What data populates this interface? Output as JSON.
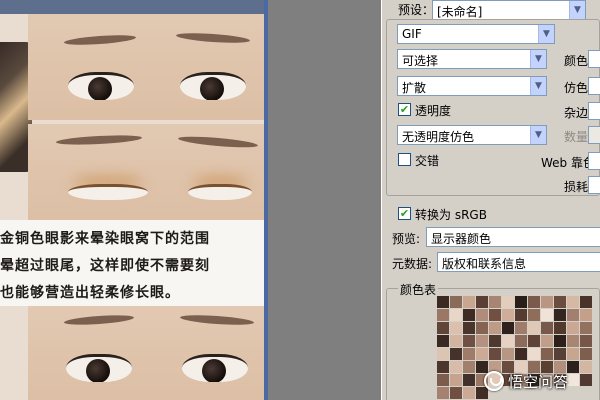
{
  "preview": {
    "caption_lines": [
      "金铜色眼影来晕染眼窝下的范围",
      "晕超过眼尾，这样即使不需要刻",
      "也能够营造出轻柔修长眼。"
    ]
  },
  "settings": {
    "preset_label": "预设：",
    "preset_value": "[未命名]",
    "format_value": "GIF",
    "reduction_value": "可选择",
    "colors_label": "颜色:",
    "dither_algo_value": "扩散",
    "dither_label": "仿色:",
    "transparency_label": "透明度",
    "transparency_checked": true,
    "matte_label": "杂边:",
    "transparency_dither_value": "无透明度仿色",
    "amount_label": "数量:",
    "interlaced_label": "交错",
    "interlaced_checked": false,
    "web_snap_label": "Web 靠色:",
    "lossy_label": "损耗:",
    "convert_srgb_label": "转换为 sRGB",
    "convert_srgb_checked": true,
    "preview_label": "预览:",
    "preview_value": "显示器颜色",
    "metadata_label": "元数据:",
    "metadata_value": "版权和联系信息",
    "color_table_label": "颜色表",
    "color_table": [
      "#3b2a22",
      "#8a6a58",
      "#c9a68f",
      "#5a4034",
      "#a88472",
      "#e3cdbd",
      "#2a1e18",
      "#7a5b4b",
      "#b99582",
      "#6b4d40",
      "#d6b8a5",
      "#4a3329",
      "#9b7866",
      "#e8d6c8",
      "#3e2c24",
      "#b08d7a",
      "#724f41",
      "#cfae99",
      "#563c30",
      "#8f6d5b",
      "#f0e2d6",
      "#332520",
      "#a3806d",
      "#c4a08b",
      "#604538",
      "#dbc0ad",
      "#49352c",
      "#866454",
      "#bd9b87",
      "#2f221c",
      "#a07d6b",
      "#e0c8b7",
      "#77584a",
      "#52392e",
      "#caa893",
      "#93715f",
      "#3a2922",
      "#d2b4a0",
      "#6e5144",
      "#b49180",
      "#4f382e",
      "#e6d1c2",
      "#8c6b5a",
      "#5e4336",
      "#c19e89",
      "#2c201a",
      "#a98672",
      "#765647",
      "#dcc4b2",
      "#45322a",
      "#9e7c69",
      "#cdaa95",
      "#684b3e",
      "#b89684",
      "#3d2b23",
      "#ecdcd0",
      "#82614f",
      "#574036",
      "#c7a58f",
      "#7e5f4f",
      "#4c362c",
      "#d8bca9",
      "#a1806e",
      "#35271f",
      "#bf9c88",
      "#6a4c3f",
      "#e4cfbf",
      "#8e6c5b",
      "#59402f",
      "#b28f7c",
      "#2e211b",
      "#d4b7a3",
      "#7c5d4d",
      "#c6a38e",
      "#42302a",
      "#9a7765",
      "#e1c9b8",
      "#634637",
      "#ae8b78",
      "#392923",
      "#d0b29e",
      "#866555",
      "#f2e6dc",
      "#503a31",
      "#a5826f",
      "#704f42",
      "#cba995",
      "#3f2d26"
    ]
  },
  "watermark": {
    "text": "悟空问答"
  }
}
